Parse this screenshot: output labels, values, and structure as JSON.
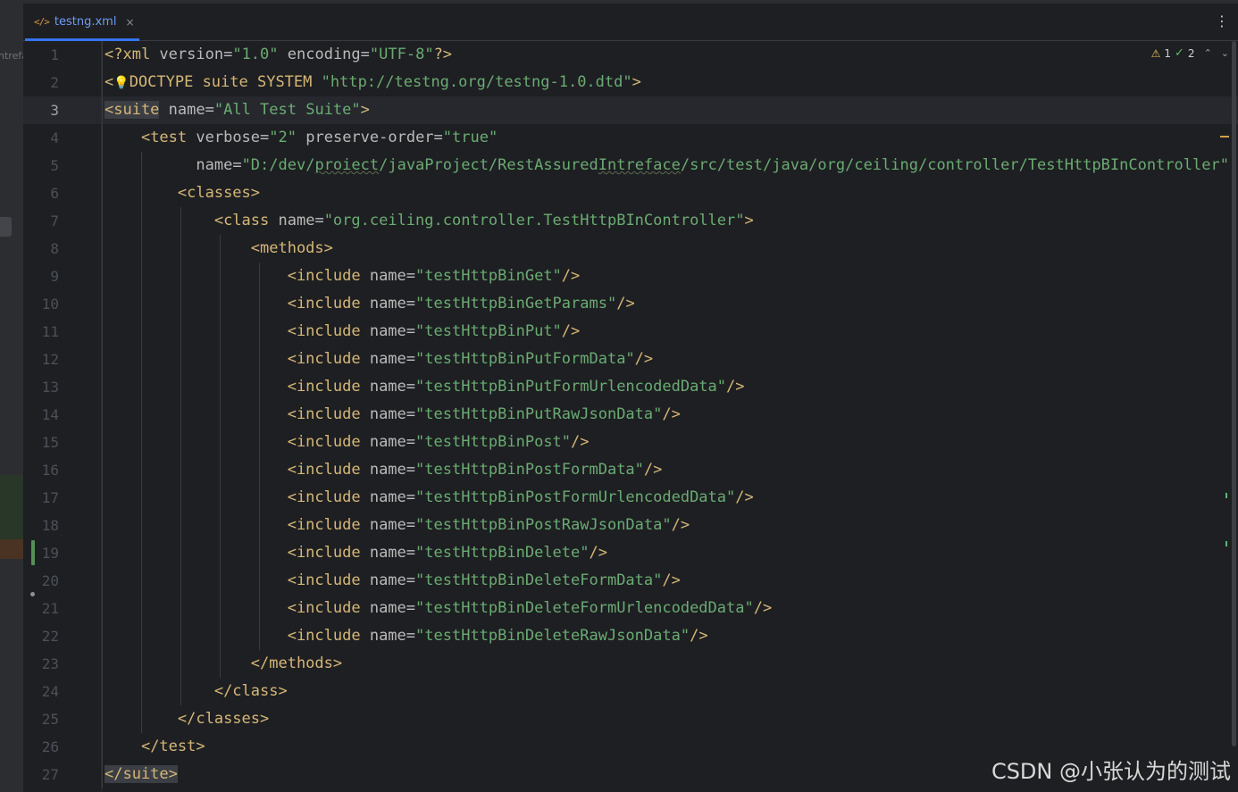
{
  "tab": {
    "icon": "xml-file-icon",
    "icon_glyph": "</>",
    "filename": "testng.xml",
    "close_glyph": "×",
    "more_glyph": "⋮"
  },
  "left_panel": {
    "clipped_text": "ntrefa"
  },
  "inspections": {
    "warnings": "1",
    "weak_warnings": "2",
    "warn_glyph": "⚠",
    "ok_glyph": "✓",
    "up_glyph": "⌃",
    "down_glyph": "⌄"
  },
  "editor": {
    "current_line": 3,
    "lines": [
      {
        "n": "1",
        "indent": "",
        "tokens": [
          [
            "t",
            "<?xml "
          ],
          [
            "a",
            "version"
          ],
          [
            "p",
            "="
          ],
          [
            "v",
            "\"1.0\""
          ],
          [
            "p",
            " "
          ],
          [
            "a",
            "encoding"
          ],
          [
            "p",
            "="
          ],
          [
            "v",
            "\"UTF-8\""
          ],
          [
            "t",
            "?>"
          ]
        ]
      },
      {
        "n": "2",
        "indent": "",
        "tokens": [
          [
            "t",
            "<"
          ],
          [
            "bulb",
            "💡"
          ],
          [
            "t",
            "DOCTYPE suite SYSTEM "
          ],
          [
            "v",
            "\"http://testng.org/testng-1.0.dtd\""
          ],
          [
            "t",
            ">"
          ]
        ]
      },
      {
        "n": "3",
        "indent": "",
        "tokens": [
          [
            "tb",
            "<suite"
          ],
          [
            "p",
            " "
          ],
          [
            "a",
            "name"
          ],
          [
            "p",
            "="
          ],
          [
            "v",
            "\"All Test Suite\""
          ],
          [
            "t",
            ">"
          ]
        ]
      },
      {
        "n": "4",
        "indent": "    ",
        "tokens": [
          [
            "t",
            "<test "
          ],
          [
            "a",
            "verbose"
          ],
          [
            "p",
            "="
          ],
          [
            "v",
            "\"2\""
          ],
          [
            "p",
            " "
          ],
          [
            "a",
            "preserve-order"
          ],
          [
            "p",
            "="
          ],
          [
            "v",
            "\"true\""
          ]
        ]
      },
      {
        "n": "5",
        "indent": "          ",
        "tokens": [
          [
            "a",
            "name"
          ],
          [
            "p",
            "="
          ],
          [
            "v",
            "\"D:/dev/"
          ],
          [
            "vs",
            "proiect"
          ],
          [
            "v",
            "/javaProject/RestAssured"
          ],
          [
            "vs",
            "Intreface"
          ],
          [
            "v",
            "/src/test/java/org/ceiling/controller/TestHttpBInController\""
          ]
        ]
      },
      {
        "n": "6",
        "indent": "        ",
        "tokens": [
          [
            "t",
            "<classes>"
          ]
        ]
      },
      {
        "n": "7",
        "indent": "            ",
        "tokens": [
          [
            "t",
            "<class "
          ],
          [
            "a",
            "name"
          ],
          [
            "p",
            "="
          ],
          [
            "v",
            "\"org.ceiling.controller.TestHttpBInController\""
          ],
          [
            "t",
            ">"
          ]
        ]
      },
      {
        "n": "8",
        "indent": "                ",
        "tokens": [
          [
            "t",
            "<methods>"
          ]
        ]
      },
      {
        "n": "9",
        "indent": "                    ",
        "tokens": [
          [
            "t",
            "<include "
          ],
          [
            "a",
            "name"
          ],
          [
            "p",
            "="
          ],
          [
            "v",
            "\"testHttpBinGet\""
          ],
          [
            "t",
            "/>"
          ]
        ]
      },
      {
        "n": "10",
        "indent": "                    ",
        "tokens": [
          [
            "t",
            "<include "
          ],
          [
            "a",
            "name"
          ],
          [
            "p",
            "="
          ],
          [
            "v",
            "\"testHttpBinGetParams\""
          ],
          [
            "t",
            "/>"
          ]
        ]
      },
      {
        "n": "11",
        "indent": "                    ",
        "tokens": [
          [
            "t",
            "<include "
          ],
          [
            "a",
            "name"
          ],
          [
            "p",
            "="
          ],
          [
            "v",
            "\"testHttpBinPut\""
          ],
          [
            "t",
            "/>"
          ]
        ]
      },
      {
        "n": "12",
        "indent": "                    ",
        "tokens": [
          [
            "t",
            "<include "
          ],
          [
            "a",
            "name"
          ],
          [
            "p",
            "="
          ],
          [
            "v",
            "\"testHttpBinPutFormData\""
          ],
          [
            "t",
            "/>"
          ]
        ]
      },
      {
        "n": "13",
        "indent": "                    ",
        "tokens": [
          [
            "t",
            "<include "
          ],
          [
            "a",
            "name"
          ],
          [
            "p",
            "="
          ],
          [
            "v",
            "\"testHttpBinPutFormUrlencodedData\""
          ],
          [
            "t",
            "/>"
          ]
        ]
      },
      {
        "n": "14",
        "indent": "                    ",
        "tokens": [
          [
            "t",
            "<include "
          ],
          [
            "a",
            "name"
          ],
          [
            "p",
            "="
          ],
          [
            "v",
            "\"testHttpBinPutRawJsonData\""
          ],
          [
            "t",
            "/>"
          ]
        ]
      },
      {
        "n": "15",
        "indent": "                    ",
        "tokens": [
          [
            "t",
            "<include "
          ],
          [
            "a",
            "name"
          ],
          [
            "p",
            "="
          ],
          [
            "v",
            "\"testHttpBinPost\""
          ],
          [
            "t",
            "/>"
          ]
        ]
      },
      {
        "n": "16",
        "indent": "                    ",
        "tokens": [
          [
            "t",
            "<include "
          ],
          [
            "a",
            "name"
          ],
          [
            "p",
            "="
          ],
          [
            "v",
            "\"testHttpBinPostFormData\""
          ],
          [
            "t",
            "/>"
          ]
        ]
      },
      {
        "n": "17",
        "indent": "                    ",
        "tokens": [
          [
            "t",
            "<include "
          ],
          [
            "a",
            "name"
          ],
          [
            "p",
            "="
          ],
          [
            "v",
            "\"testHttpBinPostFormUrlencodedData\""
          ],
          [
            "t",
            "/>"
          ]
        ]
      },
      {
        "n": "18",
        "indent": "                    ",
        "tokens": [
          [
            "t",
            "<include "
          ],
          [
            "a",
            "name"
          ],
          [
            "p",
            "="
          ],
          [
            "v",
            "\"testHttpBinPostRawJsonData\""
          ],
          [
            "t",
            "/>"
          ]
        ]
      },
      {
        "n": "19",
        "indent": "                    ",
        "tokens": [
          [
            "t",
            "<include "
          ],
          [
            "a",
            "name"
          ],
          [
            "p",
            "="
          ],
          [
            "v",
            "\"testHttpBinDelete\""
          ],
          [
            "t",
            "/>"
          ]
        ]
      },
      {
        "n": "20",
        "indent": "                    ",
        "tokens": [
          [
            "t",
            "<include "
          ],
          [
            "a",
            "name"
          ],
          [
            "p",
            "="
          ],
          [
            "v",
            "\"testHttpBinDeleteFormData\""
          ],
          [
            "t",
            "/>"
          ]
        ]
      },
      {
        "n": "21",
        "indent": "                    ",
        "tokens": [
          [
            "t",
            "<include "
          ],
          [
            "a",
            "name"
          ],
          [
            "p",
            "="
          ],
          [
            "v",
            "\"testHttpBinDeleteFormUrlencodedData\""
          ],
          [
            "t",
            "/>"
          ]
        ]
      },
      {
        "n": "22",
        "indent": "                    ",
        "tokens": [
          [
            "t",
            "<include "
          ],
          [
            "a",
            "name"
          ],
          [
            "p",
            "="
          ],
          [
            "v",
            "\"testHttpBinDeleteRawJsonData\""
          ],
          [
            "t",
            "/>"
          ]
        ]
      },
      {
        "n": "23",
        "indent": "                ",
        "tokens": [
          [
            "t",
            "</methods>"
          ]
        ]
      },
      {
        "n": "24",
        "indent": "            ",
        "tokens": [
          [
            "t",
            "</class>"
          ]
        ]
      },
      {
        "n": "25",
        "indent": "        ",
        "tokens": [
          [
            "t",
            "</classes>"
          ]
        ]
      },
      {
        "n": "26",
        "indent": "    ",
        "tokens": [
          [
            "t",
            "</test>"
          ]
        ]
      },
      {
        "n": "27",
        "indent": "",
        "tokens": [
          [
            "tb",
            "</suite>"
          ]
        ]
      }
    ]
  },
  "watermark": "CSDN @小张认为的测试",
  "colors": {
    "tag": "#d5b778",
    "attr": "#bababa",
    "value": "#6aab73",
    "bg": "#1e1f22",
    "accent": "#3574f0"
  }
}
